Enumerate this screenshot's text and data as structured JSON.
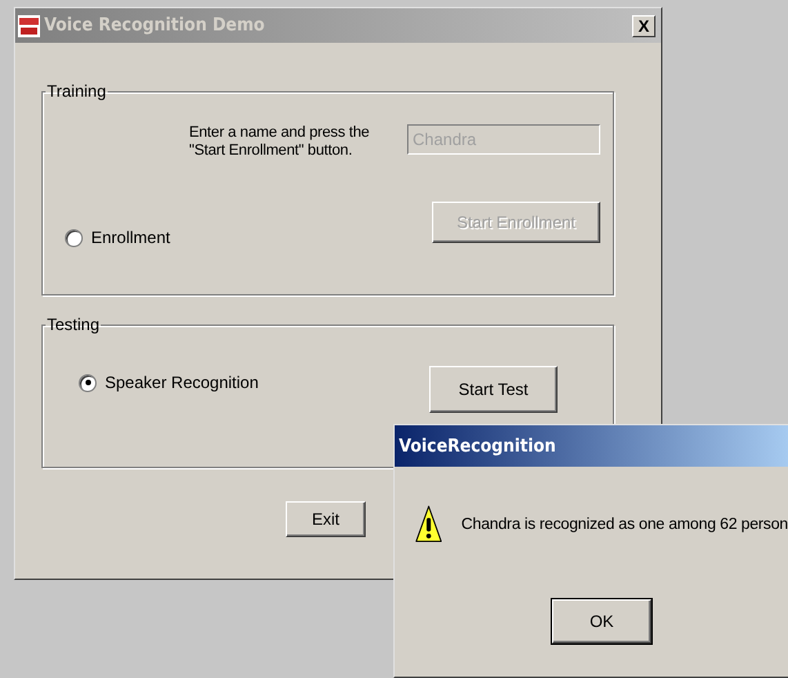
{
  "window": {
    "title": "Voice Recognition Demo",
    "close_button": "X"
  },
  "training": {
    "label": "Training",
    "option": {
      "label": "Enrollment",
      "selected": false
    },
    "instructions": "Enter a name and press the \"Start Enrollment\" button.",
    "name_field": {
      "value": "Chandra",
      "disabled": true
    },
    "button": {
      "label": "Start Enrollment",
      "disabled": true
    }
  },
  "testing": {
    "label": "Testing",
    "option": {
      "label": "Speaker Recognition",
      "selected": true
    },
    "button": {
      "label": "Start Test",
      "disabled": false
    }
  },
  "buttons": [
    "Exit"
  ],
  "dialog": {
    "title": "VoiceRecognition",
    "message": "Chandra is recognized as one among 62 person",
    "buttons": [
      "OK"
    ]
  }
}
